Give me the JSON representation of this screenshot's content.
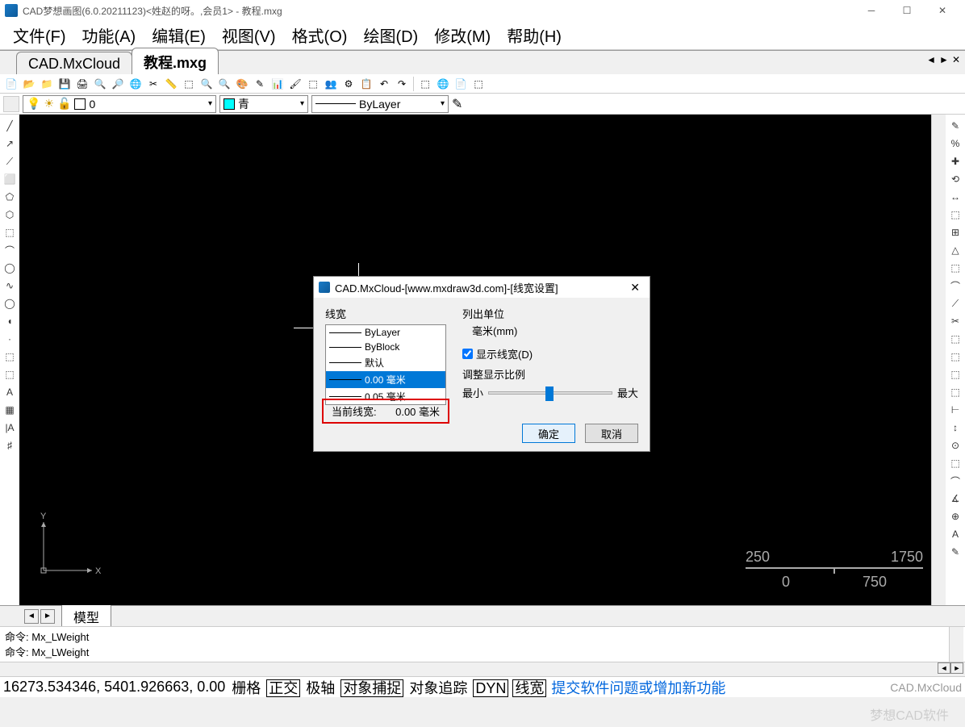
{
  "title": "CAD梦想画图(6.0.20211123)<姓赵的呀。,会员1> - 教程.mxg",
  "menu": [
    "文件(F)",
    "功能(A)",
    "编辑(E)",
    "视图(V)",
    "格式(O)",
    "绘图(D)",
    "修改(M)",
    "帮助(H)"
  ],
  "tabs": {
    "inactive": "CAD.MxCloud",
    "active": "教程.mxg"
  },
  "layer": {
    "name": "0",
    "color": "青",
    "linetype": "ByLayer"
  },
  "model_tab": "模型",
  "cmd": {
    "prompt": "命令:",
    "line1": "Mx_LWeight",
    "line2": "Mx_LWeight"
  },
  "status": {
    "coords": "16273.534346,  5401.926663,  0.00",
    "toggles": [
      "栅格",
      "正交",
      "极轴",
      "对象捕捉",
      "对象追踪",
      "DYN",
      "线宽"
    ],
    "link": "提交软件问题或增加新功能",
    "brand": "CAD.MxCloud"
  },
  "scale": {
    "t1": "250",
    "t2": "1750",
    "b1": "0",
    "b2": "750"
  },
  "ucs": {
    "x": "X",
    "y": "Y"
  },
  "dialog": {
    "title": "CAD.MxCloud-[www.mxdraw3d.com]-[线宽设置]",
    "lw_label": "线宽",
    "items": [
      "ByLayer",
      "ByBlock",
      "默认",
      "0.00 毫米",
      "0.05 毫米"
    ],
    "selected_index": 3,
    "unit_label": "列出单位",
    "unit_value": "毫米(mm)",
    "show_lw": "显示线宽(D)",
    "adjust": "调整显示比例",
    "min": "最小",
    "max": "最大",
    "current_label": "当前线宽:",
    "current_value": "0.00 毫米",
    "ok": "确定",
    "cancel": "取消"
  },
  "watermark": "梦想CAD软件"
}
